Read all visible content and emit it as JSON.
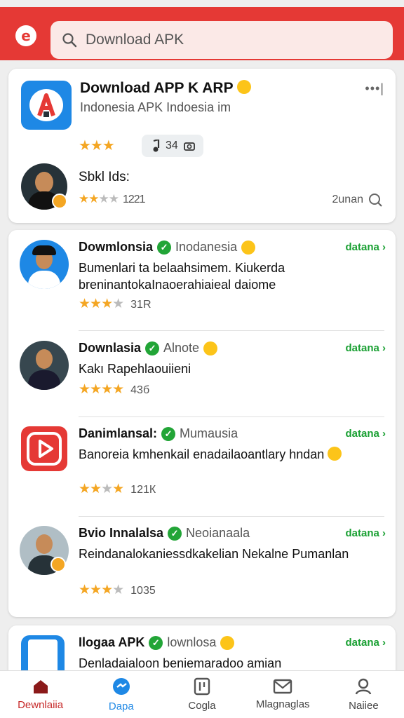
{
  "search": {
    "placeholder": "Download APK"
  },
  "featured": {
    "title": "Download APP K ARP",
    "subtitle": "Indonesia APK  Indoesia im",
    "more": "•••|",
    "stars": "★★★",
    "pill_count": "34",
    "reviewer_name": "Sbkl Ids:",
    "reviewer_count": "1221",
    "time": "2unan"
  },
  "items": [
    {
      "name": "Dowmlonsia",
      "source": "Inodanesia",
      "desc": "Bumenlari ta belaahsimem. Kiukerda breninantokaInaoerahiaieal daiome",
      "rating_count": "31R",
      "action": "datana ›"
    },
    {
      "name": "Downlasia",
      "source": "Alnote",
      "desc": "Kakı Rapehlaouiieni",
      "rating_count": "43б",
      "action": "datana ›"
    },
    {
      "name": "Danimlansal:",
      "source": "Mumausia",
      "desc": "Banoreia kmhenkail enadailaoantlary hndan",
      "rating_count": "121К",
      "action": "datana ›"
    },
    {
      "name": "Bvio Innalalsa",
      "source": "Neoianaala",
      "desc": "Reindanalokaniessdkakelian  Nekalne Pumanlan",
      "rating_count": "1035",
      "action": "datana ›"
    }
  ],
  "card3": {
    "name": "Ilogaa APK",
    "source": "lownlosa",
    "desc": "Denladaialoon beniemaradoo amian",
    "action": "datana ›"
  },
  "nav": [
    {
      "label": "Dewnlaiia"
    },
    {
      "label": "Dapa"
    },
    {
      "label": "Cogla"
    },
    {
      "label": "Mlagnaglas"
    },
    {
      "label": "Naiiee"
    }
  ],
  "colors": {
    "brand": "#e53935",
    "verify": "#22a537",
    "star": "#f4a623",
    "link": "#1aa033"
  }
}
